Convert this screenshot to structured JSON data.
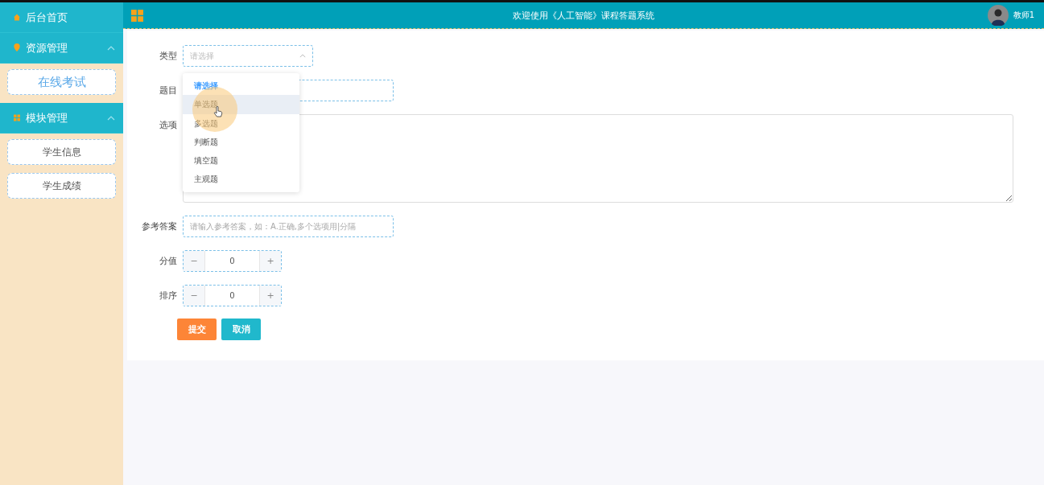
{
  "header": {
    "title": "欢迎使用《人工智能》课程答题系统",
    "user": "教师1"
  },
  "sidebar": {
    "home": "后台首页",
    "groups": [
      {
        "label": "资源管理",
        "expanded": true,
        "items": [
          {
            "label": "在线考试",
            "selected": true
          }
        ]
      },
      {
        "label": "模块管理",
        "expanded": true,
        "items": [
          {
            "label": "学生信息",
            "selected": false
          },
          {
            "label": "学生成绩",
            "selected": false
          }
        ]
      }
    ]
  },
  "form": {
    "fields": [
      {
        "kind": "select",
        "label": "类型",
        "placeholder": "请选择",
        "expanded": true,
        "options": [
          {
            "label": "请选择",
            "selected": true,
            "hovered": false
          },
          {
            "label": "单选题",
            "selected": false,
            "hovered": true
          },
          {
            "label": "多选题",
            "selected": false,
            "hovered": false
          },
          {
            "label": "判断题",
            "selected": false,
            "hovered": false
          },
          {
            "label": "填空题",
            "selected": false,
            "hovered": false
          },
          {
            "label": "主观题",
            "selected": false,
            "hovered": false
          }
        ]
      },
      {
        "kind": "input",
        "label": "题目"
      },
      {
        "kind": "textarea",
        "label": "选项"
      },
      {
        "kind": "input",
        "label": "参考答案",
        "placeholder": "请输入参考答案，如：A.正确,多个选项用|分隔"
      },
      {
        "kind": "number",
        "label": "分值",
        "value": "0",
        "minus": "−",
        "plus": "+"
      },
      {
        "kind": "number",
        "label": "排序",
        "value": "0",
        "minus": "−",
        "plus": "+"
      }
    ],
    "buttons": [
      {
        "label": "提交",
        "kind": "primary"
      },
      {
        "label": "取消",
        "kind": "secondary"
      }
    ]
  }
}
